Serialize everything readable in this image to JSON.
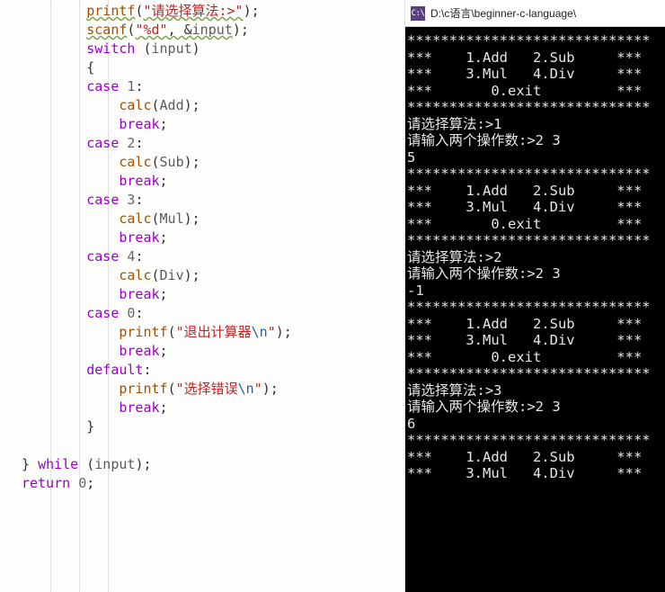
{
  "editor": {
    "lines": [
      [
        {
          "cls": "fn wavy",
          "t": "printf"
        },
        {
          "cls": "punc",
          "t": "("
        },
        {
          "cls": "str wavy",
          "t": "\"请选择算法:>\""
        },
        {
          "cls": "punc",
          "t": ");"
        }
      ],
      [
        {
          "cls": "fn wavy",
          "t": "scanf"
        },
        {
          "cls": "punc",
          "t": "("
        },
        {
          "cls": "str wavy",
          "t": "\"%d\""
        },
        {
          "cls": "punc wavy",
          "t": ", "
        },
        {
          "cls": "punc wavy",
          "t": "&"
        },
        {
          "cls": "ident wavy",
          "t": "input"
        },
        {
          "cls": "punc",
          "t": ");"
        }
      ],
      [
        {
          "cls": "kw",
          "t": "switch"
        },
        {
          "cls": "punc",
          "t": " ("
        },
        {
          "cls": "ident",
          "t": "input"
        },
        {
          "cls": "punc",
          "t": ")"
        }
      ],
      [
        {
          "cls": "punc",
          "t": "{"
        }
      ],
      [
        {
          "cls": "kw",
          "t": "case"
        },
        {
          "cls": "punc",
          "t": " "
        },
        {
          "cls": "num",
          "t": "1"
        },
        {
          "cls": "punc",
          "t": ":"
        }
      ],
      [
        {
          "cls": "fn",
          "t": "calc"
        },
        {
          "cls": "punc",
          "t": "("
        },
        {
          "cls": "ident",
          "t": "Add"
        },
        {
          "cls": "punc",
          "t": ");"
        }
      ],
      [
        {
          "cls": "kw",
          "t": "break"
        },
        {
          "cls": "punc",
          "t": ";"
        }
      ],
      [
        {
          "cls": "kw",
          "t": "case"
        },
        {
          "cls": "punc",
          "t": " "
        },
        {
          "cls": "num",
          "t": "2"
        },
        {
          "cls": "punc",
          "t": ":"
        }
      ],
      [
        {
          "cls": "fn",
          "t": "calc"
        },
        {
          "cls": "punc",
          "t": "("
        },
        {
          "cls": "ident",
          "t": "Sub"
        },
        {
          "cls": "punc",
          "t": ");"
        }
      ],
      [
        {
          "cls": "kw",
          "t": "break"
        },
        {
          "cls": "punc",
          "t": ";"
        }
      ],
      [
        {
          "cls": "kw",
          "t": "case"
        },
        {
          "cls": "punc",
          "t": " "
        },
        {
          "cls": "num",
          "t": "3"
        },
        {
          "cls": "punc",
          "t": ":"
        }
      ],
      [
        {
          "cls": "fn",
          "t": "calc"
        },
        {
          "cls": "punc",
          "t": "("
        },
        {
          "cls": "ident",
          "t": "Mul"
        },
        {
          "cls": "punc",
          "t": ");"
        }
      ],
      [
        {
          "cls": "kw",
          "t": "break"
        },
        {
          "cls": "punc",
          "t": ";"
        }
      ],
      [
        {
          "cls": "kw",
          "t": "case"
        },
        {
          "cls": "punc",
          "t": " "
        },
        {
          "cls": "num",
          "t": "4"
        },
        {
          "cls": "punc",
          "t": ":"
        }
      ],
      [
        {
          "cls": "fn",
          "t": "calc"
        },
        {
          "cls": "punc",
          "t": "("
        },
        {
          "cls": "ident",
          "t": "Div"
        },
        {
          "cls": "punc",
          "t": ");"
        }
      ],
      [
        {
          "cls": "kw",
          "t": "break"
        },
        {
          "cls": "punc",
          "t": ";"
        }
      ],
      [
        {
          "cls": "kw",
          "t": "case"
        },
        {
          "cls": "punc",
          "t": " "
        },
        {
          "cls": "num",
          "t": "0"
        },
        {
          "cls": "punc",
          "t": ":"
        }
      ],
      [
        {
          "cls": "fn",
          "t": "printf"
        },
        {
          "cls": "punc",
          "t": "("
        },
        {
          "cls": "str",
          "t": "\"退出计算器"
        },
        {
          "cls": "esc",
          "t": "\\n"
        },
        {
          "cls": "str",
          "t": "\""
        },
        {
          "cls": "punc",
          "t": ");"
        }
      ],
      [
        {
          "cls": "kw",
          "t": "break"
        },
        {
          "cls": "punc",
          "t": ";"
        }
      ],
      [
        {
          "cls": "kw",
          "t": "default"
        },
        {
          "cls": "punc",
          "t": ":"
        }
      ],
      [
        {
          "cls": "fn",
          "t": "printf"
        },
        {
          "cls": "punc",
          "t": "("
        },
        {
          "cls": "str",
          "t": "\"选择错误"
        },
        {
          "cls": "esc",
          "t": "\\n"
        },
        {
          "cls": "str",
          "t": "\""
        },
        {
          "cls": "punc",
          "t": ");"
        }
      ],
      [
        {
          "cls": "kw",
          "t": "break"
        },
        {
          "cls": "punc",
          "t": ";"
        }
      ],
      [
        {
          "cls": "punc",
          "t": "}"
        }
      ],
      [],
      [
        {
          "cls": "punc",
          "t": "} "
        },
        {
          "cls": "kw",
          "t": "while"
        },
        {
          "cls": "punc",
          "t": " ("
        },
        {
          "cls": "ident",
          "t": "input"
        },
        {
          "cls": "punc",
          "t": ");"
        }
      ],
      [
        {
          "cls": "kw",
          "t": "return"
        },
        {
          "cls": "punc",
          "t": " "
        },
        {
          "cls": "num",
          "t": "0"
        },
        {
          "cls": "punc",
          "t": ";"
        }
      ]
    ],
    "indents": [
      2,
      2,
      2,
      2,
      2,
      3,
      3,
      2,
      3,
      3,
      2,
      3,
      3,
      2,
      3,
      3,
      2,
      3,
      3,
      2,
      3,
      3,
      2,
      0,
      0,
      0
    ]
  },
  "console": {
    "title": "D:\\c语言\\beginner-c-language\\",
    "icon_text": "C:\\",
    "body": "*****************************\n***    1.Add   2.Sub     ***\n***    3.Mul   4.Div     ***\n***       0.exit         ***\n*****************************\n请选择算法:>1\n请输入两个操作数:>2 3\n5\n*****************************\n***    1.Add   2.Sub     ***\n***    3.Mul   4.Div     ***\n***       0.exit         ***\n*****************************\n请选择算法:>2\n请输入两个操作数:>2 3\n-1\n*****************************\n***    1.Add   2.Sub     ***\n***    3.Mul   4.Div     ***\n***       0.exit         ***\n*****************************\n请选择算法:>3\n请输入两个操作数:>2 3\n6\n*****************************\n***    1.Add   2.Sub     ***\n***    3.Mul   4.Div     ***"
  }
}
